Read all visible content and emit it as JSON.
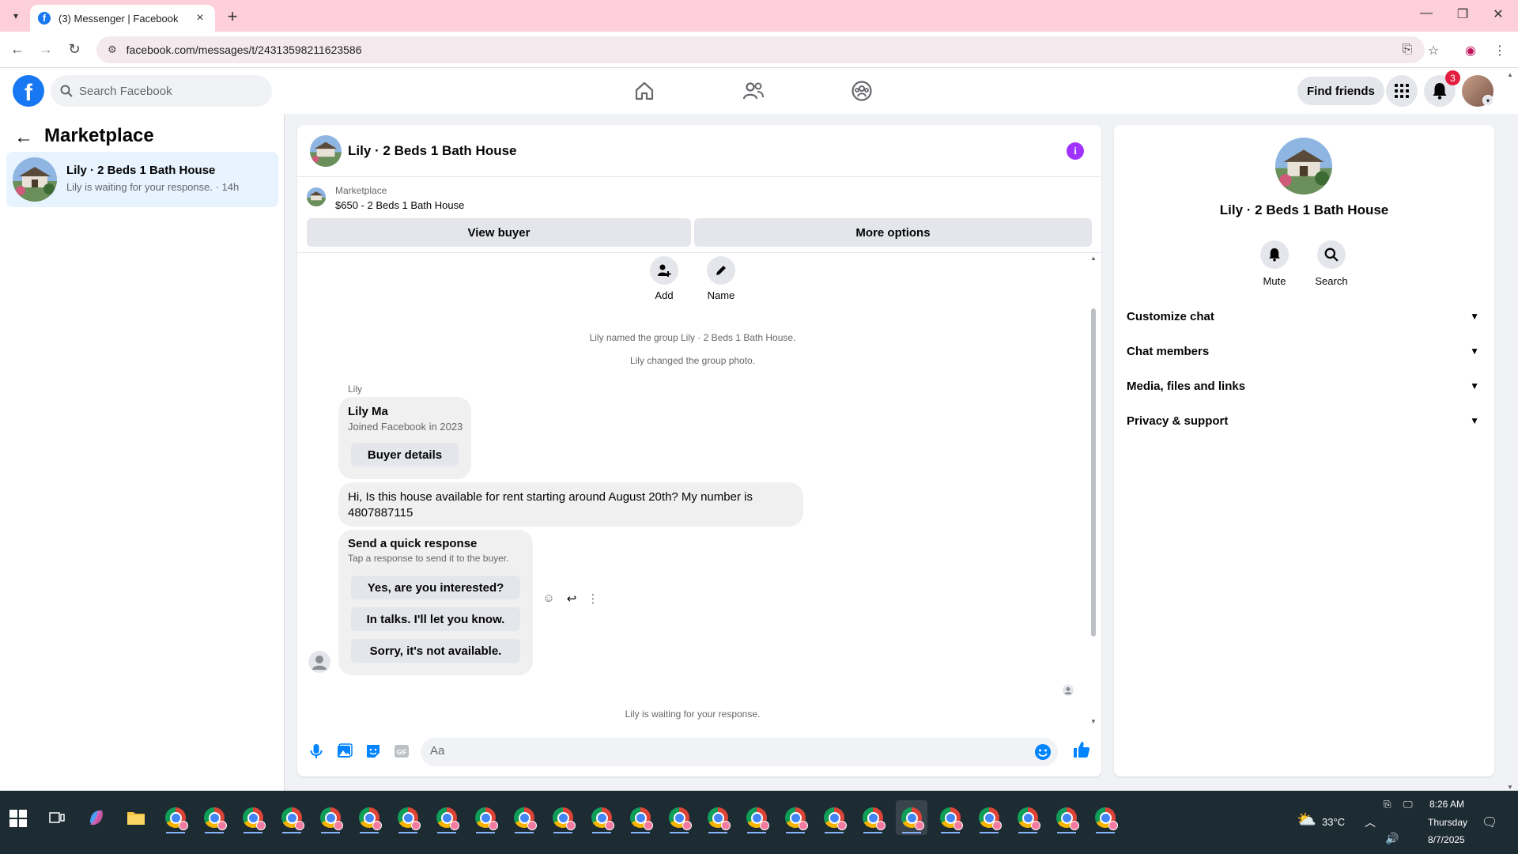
{
  "browser": {
    "tab_title": "(3) Messenger | Facebook",
    "url": "facebook.com/messages/t/24313598211623586",
    "icons": [
      "tab-list",
      "facebook-favicon",
      "close",
      "new-tab",
      "minimize",
      "maximize",
      "close-window",
      "back",
      "forward",
      "reload",
      "site-settings",
      "install-app",
      "bookmark-star",
      "profile",
      "menu"
    ]
  },
  "fb_nav": {
    "search_placeholder": "Search Facebook",
    "find_friends_label": "Find friends",
    "notification_count": "3",
    "brand_color": "#1877f2"
  },
  "sidebar": {
    "title": "Marketplace",
    "conversation": {
      "name": "Lily · 2 Beds 1 Bath House",
      "preview": "Lily is waiting for your response. · 14h"
    }
  },
  "chat": {
    "header_title": "Lily · 2 Beds 1 Bath House",
    "marketplace_label": "Marketplace",
    "marketplace_item": "$650 - 2 Beds 1 Bath House",
    "view_buyer_label": "View buyer",
    "more_options_label": "More options",
    "actions": [
      {
        "label": "Add"
      },
      {
        "label": "Name"
      }
    ],
    "system_messages": [
      "Lily named the group Lily · 2 Beds 1 Bath House.",
      "Lily changed the group photo."
    ],
    "sender_name": "Lily",
    "buyer_card": {
      "name": "Lily Ma",
      "subtitle": "Joined Facebook in 2023",
      "button_label": "Buyer details"
    },
    "message_text": "Hi, Is this house available for rent starting around August 20th?  My number is 4807887115",
    "quick_response": {
      "title": "Send a quick response",
      "subtitle": "Tap a response to send it to the buyer.",
      "options": [
        "Yes, are you interested?",
        "In talks. I'll let you know.",
        "Sorry, it's not available."
      ]
    },
    "waiting_text": "Lily is waiting for your response.",
    "composer_placeholder": "Aa",
    "accent_color": "#0084ff"
  },
  "info_panel": {
    "title": "Lily · 2 Beds 1 Bath House",
    "mute_label": "Mute",
    "search_label": "Search",
    "rows": [
      "Customize chat",
      "Chat members",
      "Media, files and links",
      "Privacy & support"
    ]
  },
  "taskbar": {
    "temperature": "33°C",
    "time": "8:26 AM",
    "day": "Thursday",
    "date": "8/7/2025"
  }
}
